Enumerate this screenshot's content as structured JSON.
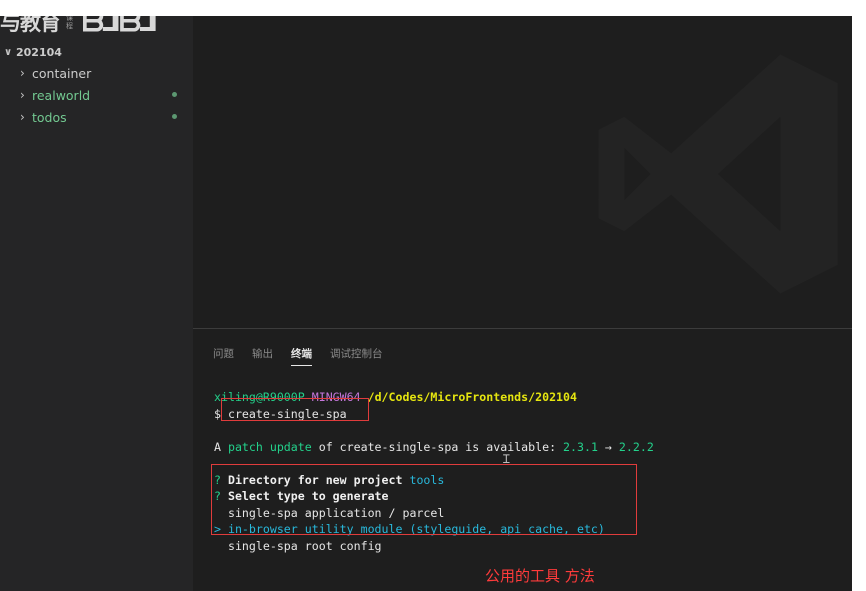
{
  "logo": {
    "cn": "与教育",
    "small": "课程",
    "bili": "bilibili"
  },
  "explorer": {
    "root": "202104",
    "items": [
      {
        "label": "container",
        "git": false
      },
      {
        "label": "realworld",
        "git": true
      },
      {
        "label": "todos",
        "git": true
      }
    ]
  },
  "panel": {
    "tabs": [
      "问题",
      "输出",
      "终端",
      "调试控制台"
    ],
    "active_tab": "终端"
  },
  "terminal": {
    "user": "xiling@R9000P",
    "shell": "MINGW64",
    "path": "/d/Codes/MicroFrontends/202104",
    "prompt": "$",
    "command": "create-single-spa",
    "update_a": "A ",
    "update_patch": "patch update",
    "update_mid": " of create-single-spa is ",
    "update_available": "available",
    "update_colon": ": ",
    "version_from": "2.3.1",
    "arrow": " → ",
    "version_to": "2.2.2",
    "q_mark": "?",
    "q1": "Directory for new project",
    "q1_answer": "tools",
    "q2": "Select type to generate",
    "opt1": "single-spa application / parcel",
    "opt_pointer": ">",
    "opt2": "in-browser utility module (styleguide, api cache, etc)",
    "opt3": "single-spa root config"
  },
  "annotation": "公用的工具 方法",
  "colors": {
    "accent_green": "#23d18b",
    "annotation_red": "#ff3b3b"
  }
}
